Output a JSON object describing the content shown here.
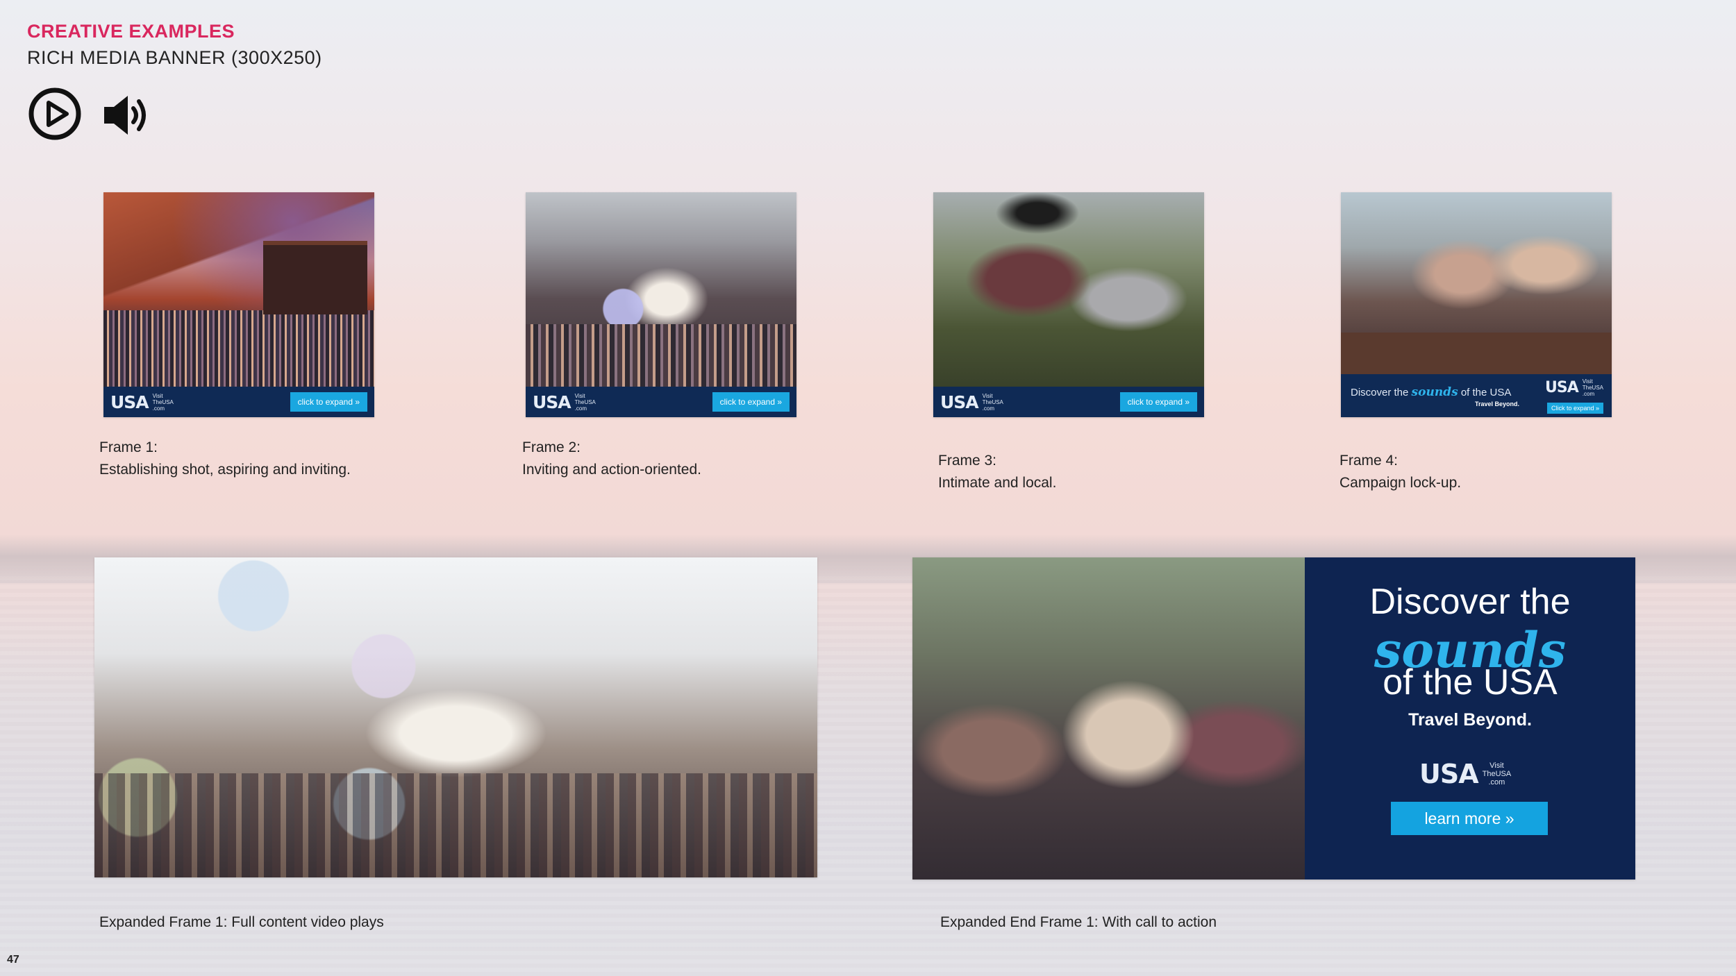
{
  "header": {
    "title": "CREATIVE EXAMPLES",
    "subtitle": "RICH MEDIA BANNER (300X250)"
  },
  "controls": {
    "play_icon": "play-circle-icon",
    "sound_icon": "speaker-volume-icon"
  },
  "banner": {
    "logo_text": "USA",
    "logo_small": [
      "Visit",
      "TheUSA",
      ".com"
    ],
    "expand_label": "click to expand »"
  },
  "frames": [
    {
      "caption_title": "Frame 1:",
      "caption_text": "Establishing shot, aspiring and inviting."
    },
    {
      "caption_title": "Frame 2:",
      "caption_text": "Inviting and action-oriented."
    },
    {
      "caption_title": "Frame 3:",
      "caption_text": "Intimate and local."
    },
    {
      "caption_title": "Frame 4:",
      "caption_text": "Campaign lock-up.",
      "tagline_pre": "Discover the",
      "tagline_script": "sounds",
      "tagline_post": "of the USA",
      "tagline_small": "Travel Beyond.",
      "expand_label": "Click to expand »"
    }
  ],
  "expanded": {
    "video_caption": "Expanded Frame 1: Full content video plays",
    "end_caption": "Expanded End Frame 1: With call to action",
    "end_card": {
      "line1": "Discover the",
      "script": "sounds",
      "line3": "of the USA",
      "travel": "Travel Beyond.",
      "cta": "learn more »"
    }
  },
  "page_number": "47",
  "colors": {
    "accent": "#d9275e",
    "navy": "#0f2a55",
    "cta_blue": "#1aa7e0"
  }
}
